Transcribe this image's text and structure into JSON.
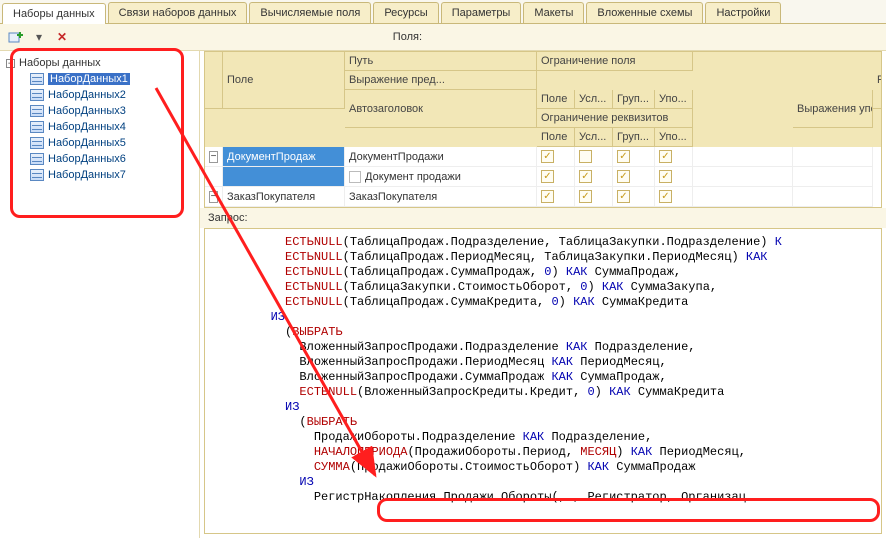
{
  "tabs": {
    "datasets": "Наборы данных",
    "links": "Связи наборов данных",
    "calc": "Вычисляемые поля",
    "resources": "Ресурсы",
    "params": "Параметры",
    "layouts": "Макеты",
    "nested": "Вложенные схемы",
    "settings": "Настройки"
  },
  "toolbar": {
    "add": "+",
    "dropdown": "▾",
    "delete": "✕"
  },
  "tree": {
    "root_label": "Наборы данных",
    "items": [
      {
        "label": "НаборДанных1"
      },
      {
        "label": "НаборДанных2"
      },
      {
        "label": "НаборДанных3"
      },
      {
        "label": "НаборДанных4"
      },
      {
        "label": "НаборДанных5"
      },
      {
        "label": "НаборДанных6"
      },
      {
        "label": "НаборДанных7"
      }
    ]
  },
  "fields": {
    "header": "Поля:",
    "h_field": "Поле",
    "h_path": "Путь",
    "h_autocaption": "Автозаголовок",
    "h_restrict_field": "Ограничение поля",
    "h_restrict_req": "Ограничение реквизитов",
    "h_pole": "Поле",
    "h_usl": "Усл...",
    "h_grup": "Груп...",
    "h_upo": "Упо...",
    "h_role": "Роль",
    "h_expr": "Выражение пред...",
    "h_expr_order": "Выражения упорядочивания",
    "rows": [
      {
        "field": "ДокументПродаж",
        "path": "ДокументПродажи",
        "sub_caption": "Документ продажи",
        "c1": true,
        "c2": false,
        "c3": true,
        "c4": true,
        "s1": true,
        "s2": true,
        "s3": true,
        "s4": true
      },
      {
        "field": "ЗаказПокупателя",
        "path": "ЗаказПокупателя",
        "c1": true,
        "c2": true,
        "c3": true,
        "c4": true
      }
    ]
  },
  "query": {
    "label": "Запрос:",
    "lines": [
      {
        "indent": 10,
        "t": [
          {
            "s": "fn",
            "v": "ЕСТЬNULL"
          },
          {
            "v": "(ТаблицаПродаж.Подразделение, ТаблицаЗакупки.Подразделение) "
          },
          {
            "s": "kwblue",
            "v": "К"
          }
        ]
      },
      {
        "indent": 10,
        "t": [
          {
            "s": "fn",
            "v": "ЕСТЬNULL"
          },
          {
            "v": "(ТаблицаПродаж.ПериодМесяц, ТаблицаЗакупки.ПериодМесяц) "
          },
          {
            "s": "kwblue",
            "v": "КАК"
          },
          {
            "v": " "
          }
        ]
      },
      {
        "indent": 10,
        "t": [
          {
            "s": "fn",
            "v": "ЕСТЬNULL"
          },
          {
            "v": "(ТаблицаПродаж.СуммаПродаж, "
          },
          {
            "s": "num",
            "v": "0"
          },
          {
            "v": ") "
          },
          {
            "s": "kwblue",
            "v": "КАК"
          },
          {
            "v": " СуммаПродаж,"
          }
        ]
      },
      {
        "indent": 10,
        "t": [
          {
            "s": "fn",
            "v": "ЕСТЬNULL"
          },
          {
            "v": "(ТаблицаЗакупки.СтоимостьОборот, "
          },
          {
            "s": "num",
            "v": "0"
          },
          {
            "v": ") "
          },
          {
            "s": "kwblue",
            "v": "КАК"
          },
          {
            "v": " СуммаЗакупа,"
          }
        ]
      },
      {
        "indent": 10,
        "t": [
          {
            "s": "fn",
            "v": "ЕСТЬNULL"
          },
          {
            "v": "(ТаблицаПродаж.СуммаКредита, "
          },
          {
            "s": "num",
            "v": "0"
          },
          {
            "v": ") "
          },
          {
            "s": "kwblue",
            "v": "КАК"
          },
          {
            "v": " СуммаКредита"
          }
        ]
      },
      {
        "indent": 8,
        "t": [
          {
            "s": "kwblue",
            "v": "ИЗ"
          }
        ]
      },
      {
        "indent": 10,
        "t": [
          {
            "v": "("
          },
          {
            "s": "kw",
            "v": "ВЫБРАТЬ"
          }
        ]
      },
      {
        "indent": 12,
        "t": [
          {
            "v": "ВложенныйЗапросПродажи.Подразделение "
          },
          {
            "s": "kwblue",
            "v": "КАК"
          },
          {
            "v": " Подразделение,"
          }
        ]
      },
      {
        "indent": 12,
        "t": [
          {
            "v": "ВложенныйЗапросПродажи.ПериодМесяц "
          },
          {
            "s": "kwblue",
            "v": "КАК"
          },
          {
            "v": " ПериодМесяц,"
          }
        ]
      },
      {
        "indent": 12,
        "t": [
          {
            "v": "ВложенныйЗапросПродажи.СуммаПродаж "
          },
          {
            "s": "kwblue",
            "v": "КАК"
          },
          {
            "v": " СуммаПродаж,"
          }
        ]
      },
      {
        "indent": 12,
        "t": [
          {
            "s": "fn",
            "v": "ЕСТЬNULL"
          },
          {
            "v": "(ВложенныйЗапросКредиты.Кредит, "
          },
          {
            "s": "num",
            "v": "0"
          },
          {
            "v": ") "
          },
          {
            "s": "kwblue",
            "v": "КАК"
          },
          {
            "v": " СуммаКредита"
          }
        ]
      },
      {
        "indent": 10,
        "t": [
          {
            "s": "kwblue",
            "v": "ИЗ"
          }
        ]
      },
      {
        "indent": 12,
        "t": [
          {
            "v": "("
          },
          {
            "s": "kw",
            "v": "ВЫБРАТЬ"
          }
        ]
      },
      {
        "indent": 14,
        "t": [
          {
            "v": "ПродажиОбороты.Подразделение "
          },
          {
            "s": "kwblue",
            "v": "КАК"
          },
          {
            "v": " Подразделение,"
          }
        ]
      },
      {
        "indent": 14,
        "t": [
          {
            "s": "fn",
            "v": "НАЧАЛОПЕРИОДА"
          },
          {
            "v": "(ПродажиОбороты.Период, "
          },
          {
            "s": "kw",
            "v": "МЕСЯЦ"
          },
          {
            "v": ") "
          },
          {
            "s": "kwblue",
            "v": "КАК"
          },
          {
            "v": " ПериодМесяц,"
          }
        ]
      },
      {
        "indent": 14,
        "t": [
          {
            "s": "fn",
            "v": "СУММА"
          },
          {
            "v": "(ПродажиОбороты.СтоимостьОборот) "
          },
          {
            "s": "kwblue",
            "v": "КАК"
          },
          {
            "v": " СуммаПродаж"
          }
        ]
      },
      {
        "indent": 12,
        "t": [
          {
            "s": "kwblue",
            "v": "ИЗ"
          }
        ]
      },
      {
        "indent": 14,
        "t": [
          {
            "v": "РегистрНакопления.Продажи.Обороты(, , Регистратор, Организац"
          }
        ]
      }
    ]
  }
}
